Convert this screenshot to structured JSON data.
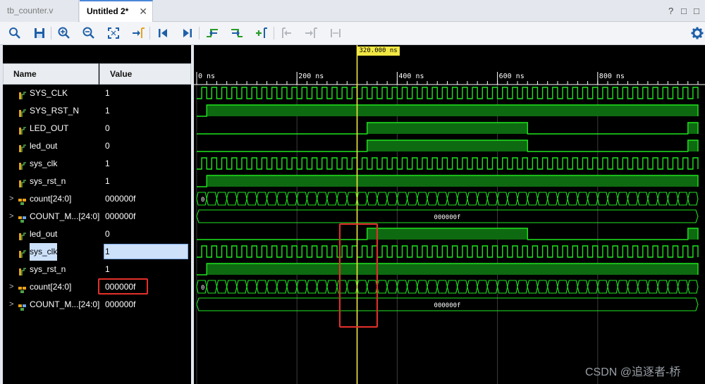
{
  "tabs": [
    {
      "label": "tb_counter.v",
      "close": ""
    },
    {
      "label": "Untitled 2*",
      "close": "✕"
    }
  ],
  "window_controls": {
    "help": "?",
    "restore": "□",
    "maximize": "□"
  },
  "toolbar": {
    "icons": [
      "search-icon",
      "save-icon",
      "zoom-in-icon",
      "zoom-out-icon",
      "zoom-fit-icon",
      "go-to-cursor-icon",
      "go-to-start-icon",
      "go-to-end-icon",
      "previous-transition-icon",
      "next-transition-icon",
      "add-marker-icon",
      "previous-marker-icon",
      "next-marker-icon",
      "swap-cursors-icon",
      "settings-gear-icon"
    ]
  },
  "columns": {
    "name": "Name",
    "value": "Value"
  },
  "signals": [
    {
      "name": "SYS_CLK",
      "value": "1",
      "kind": "bit",
      "expand": ""
    },
    {
      "name": "SYS_RST_N",
      "value": "1",
      "kind": "bit",
      "expand": ""
    },
    {
      "name": "LED_OUT",
      "value": "0",
      "kind": "bit",
      "expand": ""
    },
    {
      "name": "led_out",
      "value": "0",
      "kind": "bit",
      "expand": ""
    },
    {
      "name": "sys_clk",
      "value": "1",
      "kind": "bit",
      "expand": ""
    },
    {
      "name": "sys_rst_n",
      "value": "1",
      "kind": "bit",
      "expand": ""
    },
    {
      "name": "count[24:0]",
      "value": "000000f",
      "kind": "bus",
      "expand": ">"
    },
    {
      "name": "COUNT_M...[24:0]",
      "value": "000000f",
      "kind": "bus",
      "expand": ">"
    },
    {
      "name": "led_out",
      "value": "0",
      "kind": "bit",
      "expand": ""
    },
    {
      "name": "sys_clk",
      "value": "1",
      "kind": "bit",
      "expand": ""
    },
    {
      "name": "sys_rst_n",
      "value": "1",
      "kind": "bit",
      "expand": ""
    },
    {
      "name": "count[24:0]",
      "value": "000000f",
      "kind": "bus",
      "expand": ">"
    },
    {
      "name": "COUNT_M...[24:0]",
      "value": "000000f",
      "kind": "bus",
      "expand": ">"
    }
  ],
  "selected_row": 9,
  "highlighted_value_row": 11,
  "time_ruler": {
    "labels": [
      "0 ns",
      "200 ns",
      "400 ns",
      "600 ns",
      "800 ns"
    ],
    "range_ns": [
      0,
      1000
    ]
  },
  "cursor": {
    "label": "320.000 ns",
    "time_ns": 320
  },
  "waveforms": {
    "clk_period_ns": 20,
    "rst_release_ns": 20,
    "led_segments_ns": [
      [
        340,
        660
      ],
      [
        980,
        1000
      ]
    ],
    "count_start_value": "0",
    "count_m_value": "000000f"
  },
  "colors": {
    "wave": "#1fe51f",
    "wave_fill": "#0e6a10",
    "cursor": "#f2e844",
    "highlight": "#e5302a",
    "grid": "#3c3c3c"
  },
  "watermark": "CSDN @追逐者-桥"
}
